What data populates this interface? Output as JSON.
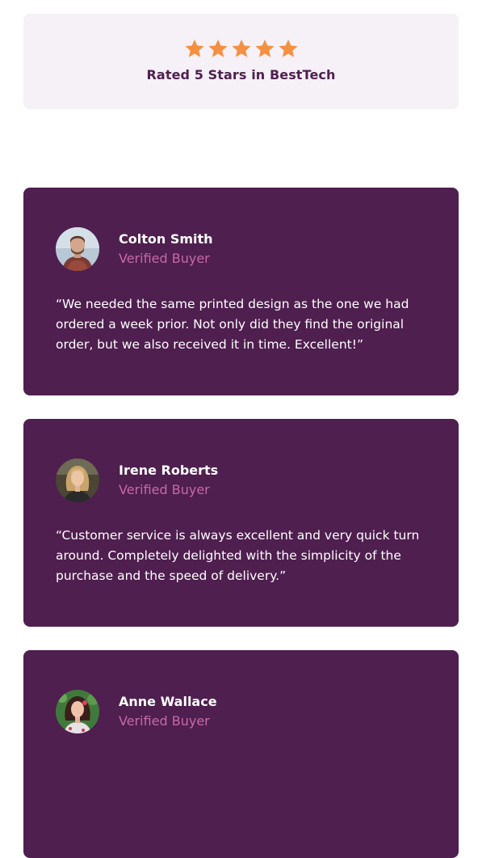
{
  "summary": {
    "stars": 5,
    "max_stars": 5,
    "rating_text": "Rated 5 Stars in BestTech",
    "star_color": "#f39041"
  },
  "reviews": [
    {
      "name": "Colton Smith",
      "role": "Verified Buyer",
      "quote": "“We needed the same printed design as the one we had ordered a week prior. Not only did they find the original order, but we also received it in time. Excellent!”"
    },
    {
      "name": "Irene Roberts",
      "role": "Verified Buyer",
      "quote": "“Customer service is always excellent and very quick turn around. Completely delighted with the simplicity of the purchase and the speed of delivery.”"
    },
    {
      "name": "Anne Wallace",
      "role": "Verified Buyer",
      "quote": ""
    }
  ],
  "colors": {
    "card_background": "#4f1f4f",
    "summary_background": "#f6f0f7",
    "role_text": "#c76aa7"
  }
}
